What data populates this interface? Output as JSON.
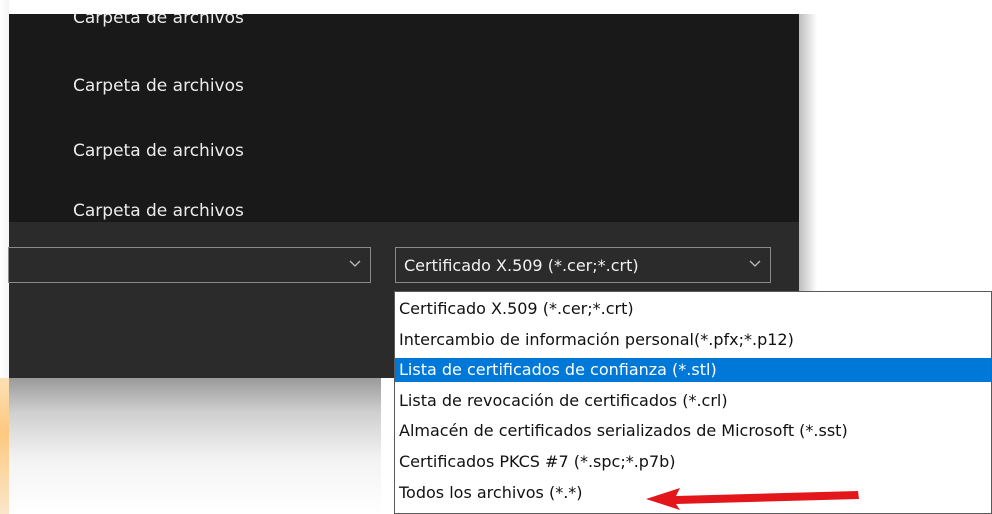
{
  "file_list": {
    "items": [
      {
        "type": "Carpeta de archivos"
      },
      {
        "type": "Carpeta de archivos"
      },
      {
        "type": "Carpeta de archivos"
      },
      {
        "type": "Carpeta de archivos"
      }
    ]
  },
  "filename_combo": {
    "value": ""
  },
  "filetype_combo": {
    "value": "Certificado X.509 (*.cer;*.crt)",
    "options": [
      "Certificado X.509 (*.cer;*.crt)",
      "Intercambio de información personal(*.pfx;*.p12)",
      "Lista de certificados de confianza (*.stl)",
      "Lista de revocación de certificados (*.crl)",
      "Almacén de certificados serializados de Microsoft (*.sst)",
      "Certificados PKCS #7 (*.spc;*.p7b)",
      "Todos los archivos (*.*)"
    ],
    "highlighted_option": "Lista de certificados de confianza (*.stl)"
  },
  "annotation": {
    "arrow_color": "#e3171b"
  },
  "colors": {
    "highlight": "#0078d7",
    "dialog_dark": "#1f1f1f"
  }
}
